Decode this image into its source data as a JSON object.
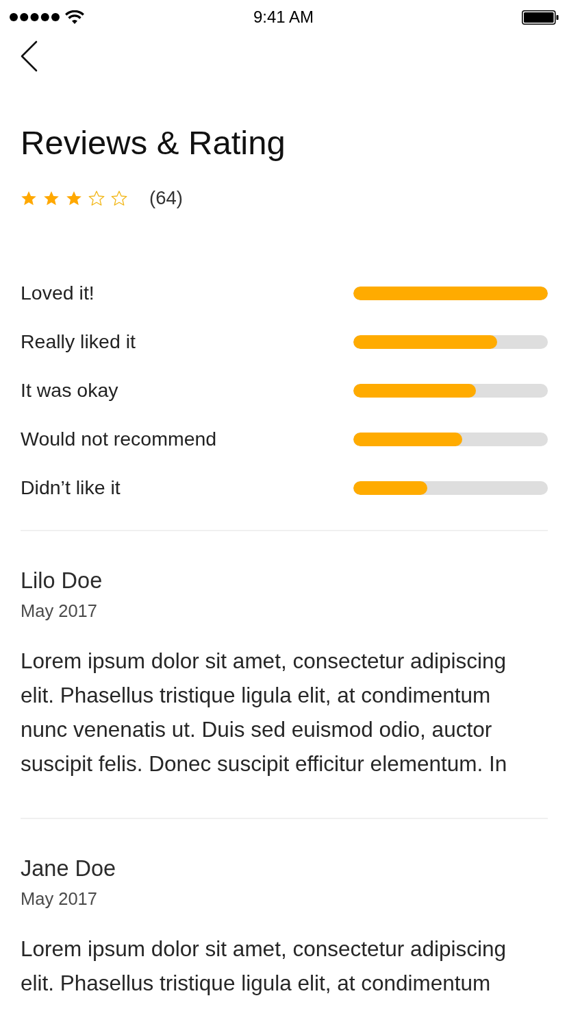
{
  "status_bar": {
    "time": "9:41 AM"
  },
  "header": {
    "title": "Reviews & Rating",
    "stars": 3,
    "count": "(64)"
  },
  "breakdown": [
    {
      "label": "Loved it!",
      "level": 1.0
    },
    {
      "label": "Really liked it",
      "level": 0.74
    },
    {
      "label": "It was okay",
      "level": 0.63
    },
    {
      "label": "Would not recommend",
      "level": 0.56
    },
    {
      "label": "Didn’t like it",
      "level": 0.38
    }
  ],
  "reviews": [
    {
      "name": "Lilo Doe",
      "date": "May 2017",
      "text": "Lorem ipsum dolor sit amet, consectetur adipiscing elit. Phasellus tristique ligula elit, at condimentum nunc venenatis ut. Duis sed euismod odio, auctor suscipit felis. Donec suscipit efficitur elementum. In"
    },
    {
      "name": "Jane Doe",
      "date": "May 2017",
      "text": "Lorem ipsum dolor sit amet, consectetur adipiscing elit. Phasellus tristique ligula elit, at condimentum"
    }
  ]
}
